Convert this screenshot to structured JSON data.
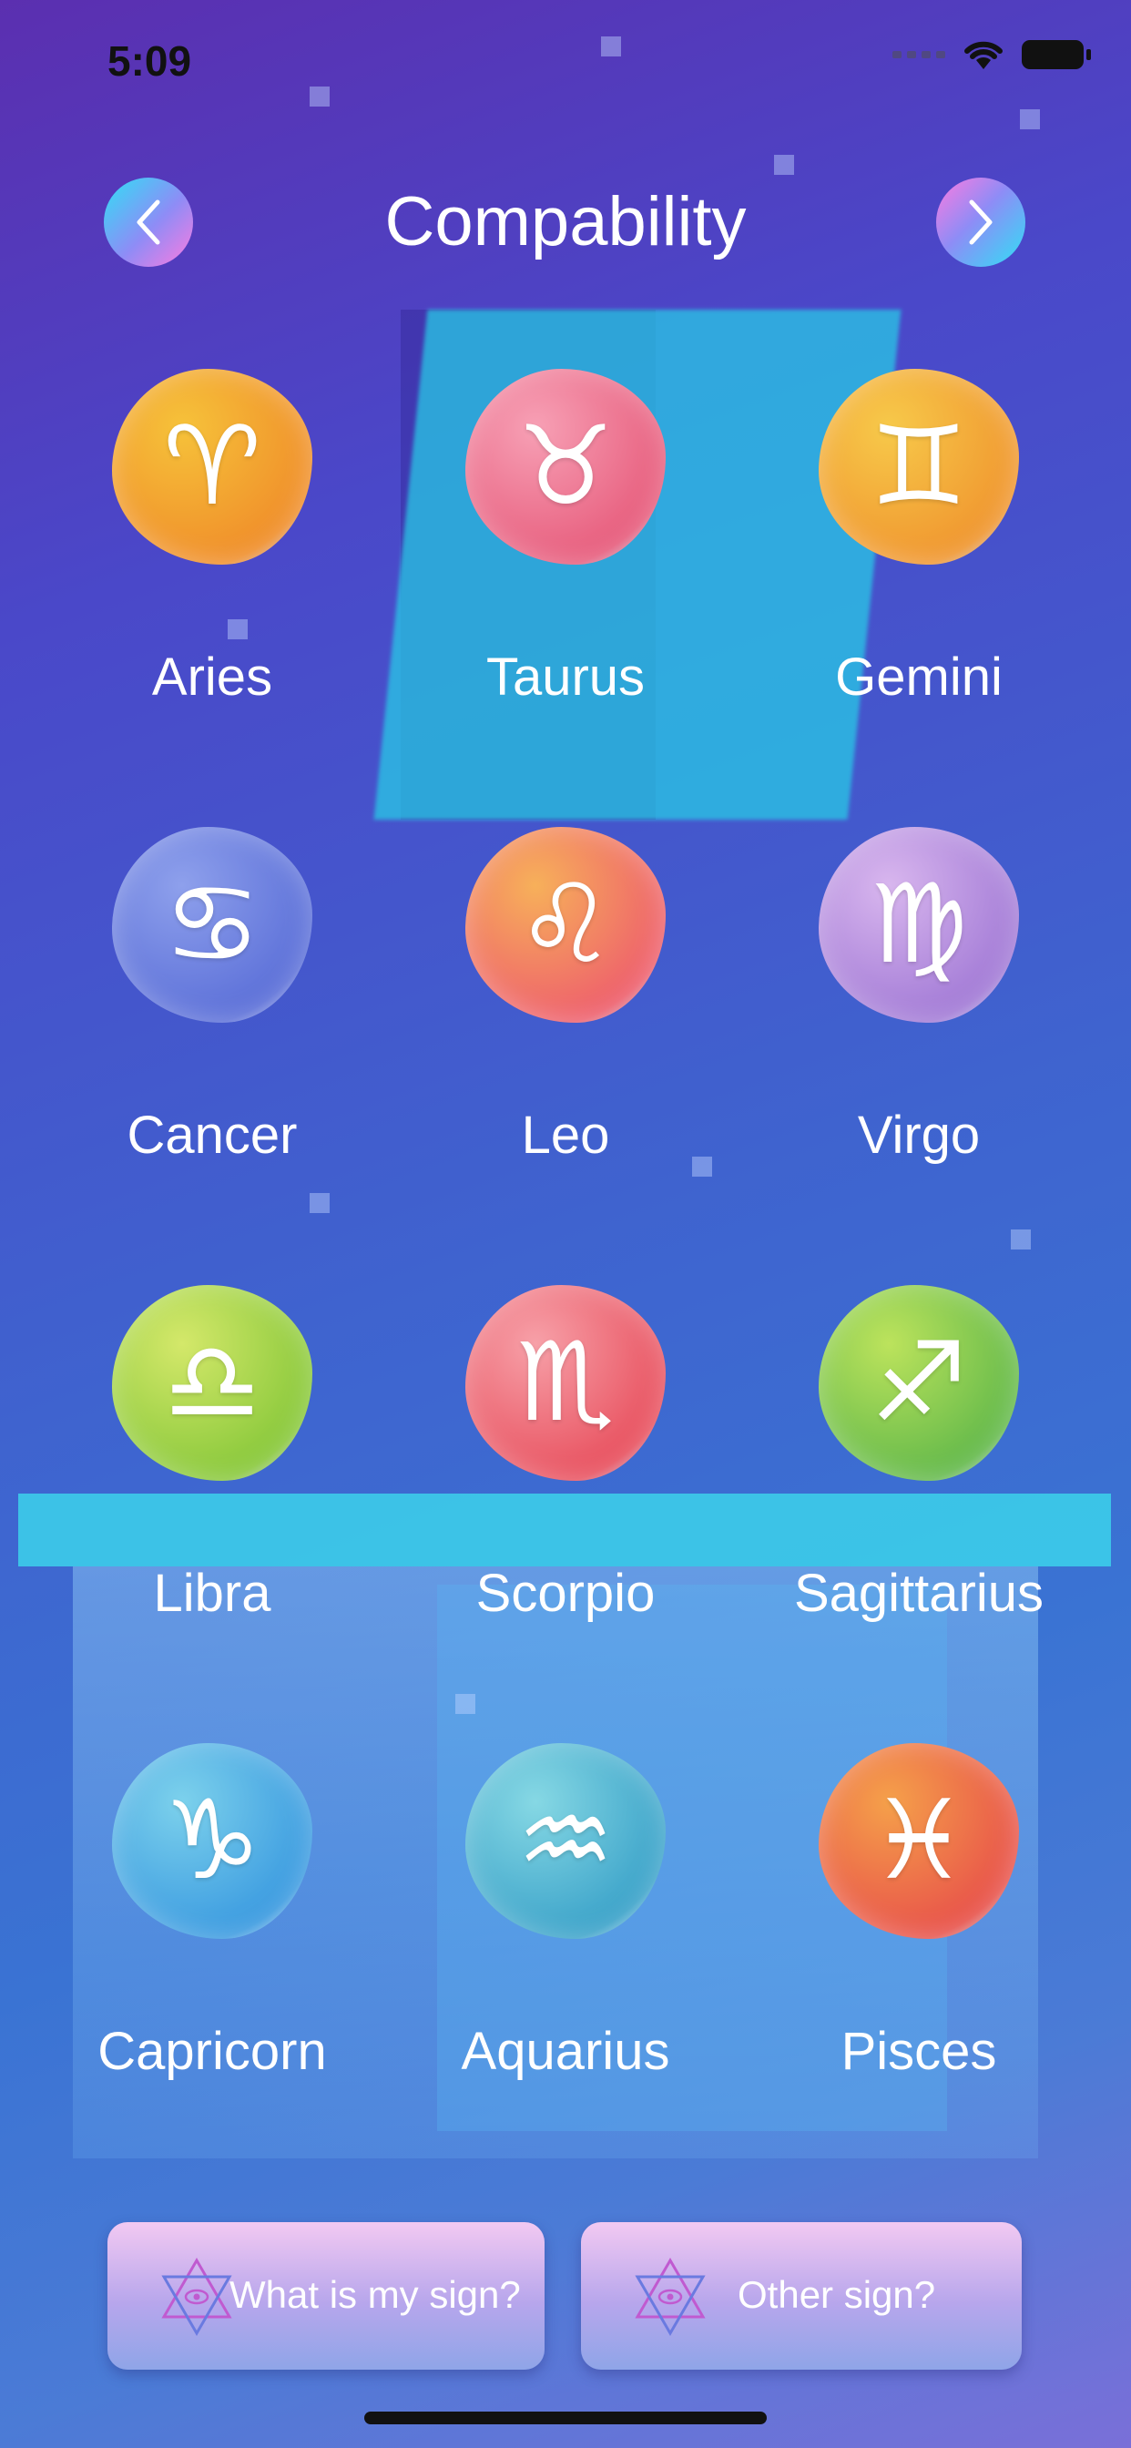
{
  "status_bar": {
    "time": "5:09"
  },
  "header": {
    "title": "Compability",
    "back_icon": "chevron-left-icon",
    "forward_icon": "chevron-right-icon"
  },
  "signs": [
    {
      "name": "Aries",
      "glyph": "♈",
      "colors": [
        "#f6c23a",
        "#f08e2a"
      ]
    },
    {
      "name": "Taurus",
      "glyph": "♉",
      "colors": [
        "#f7a0b5",
        "#e75c7c"
      ]
    },
    {
      "name": "Gemini",
      "glyph": "♊",
      "colors": [
        "#f7c94a",
        "#f0962f"
      ]
    },
    {
      "name": "Cancer",
      "glyph": "♋",
      "colors": [
        "#8ea0ec",
        "#5b6fd8"
      ]
    },
    {
      "name": "Leo",
      "glyph": "♌",
      "colors": [
        "#f7b05a",
        "#ee5f6c"
      ]
    },
    {
      "name": "Virgo",
      "glyph": "♍",
      "colors": [
        "#d8b6ee",
        "#a27ad6"
      ]
    },
    {
      "name": "Libra",
      "glyph": "♎",
      "colors": [
        "#d4e86a",
        "#88c83a"
      ]
    },
    {
      "name": "Scorpio",
      "glyph": "♏",
      "colors": [
        "#f7a0a8",
        "#e8505e"
      ]
    },
    {
      "name": "Sagittarius",
      "glyph": "♐",
      "colors": [
        "#bce35c",
        "#63b94a"
      ]
    },
    {
      "name": "Capricorn",
      "glyph": "♑",
      "colors": [
        "#7cd1ec",
        "#3a9ae0"
      ]
    },
    {
      "name": "Aquarius",
      "glyph": "♒",
      "colors": [
        "#86d8e4",
        "#3aa2c9"
      ]
    },
    {
      "name": "Pisces",
      "glyph": "♓",
      "colors": [
        "#f5a04a",
        "#e8524a"
      ]
    }
  ],
  "bottom_buttons": {
    "my_sign": "What is my sign?",
    "other_sign": "Other sign?",
    "icon": "star-of-david-eye-icon"
  }
}
